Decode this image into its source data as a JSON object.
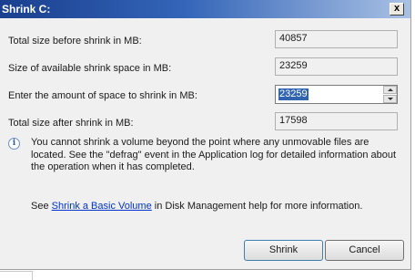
{
  "window": {
    "title": "Shrink C:",
    "close_glyph": "x"
  },
  "fields": {
    "total_before": {
      "label": "Total size before shrink in MB:",
      "value": "40857"
    },
    "available": {
      "label": "Size of available shrink space in MB:",
      "value": "23259"
    },
    "amount": {
      "label": "Enter the amount of space to shrink in MB:",
      "value": "23259"
    },
    "total_after": {
      "label": "Total size after shrink in MB:",
      "value": "17598"
    }
  },
  "info": {
    "icon": "info-icon",
    "text": "You cannot shrink a volume beyond the point where any unmovable files are located. See the \"defrag\" event in the Application log for detailed information about the operation when it has completed."
  },
  "help": {
    "prefix": "See ",
    "link": "Shrink a Basic Volume",
    "suffix": " in Disk Management help for more information."
  },
  "buttons": {
    "shrink": "Shrink",
    "cancel": "Cancel"
  },
  "colors": {
    "title_bar": "#1a3f8f",
    "selection": "#3063b0",
    "link": "#0033cc"
  }
}
